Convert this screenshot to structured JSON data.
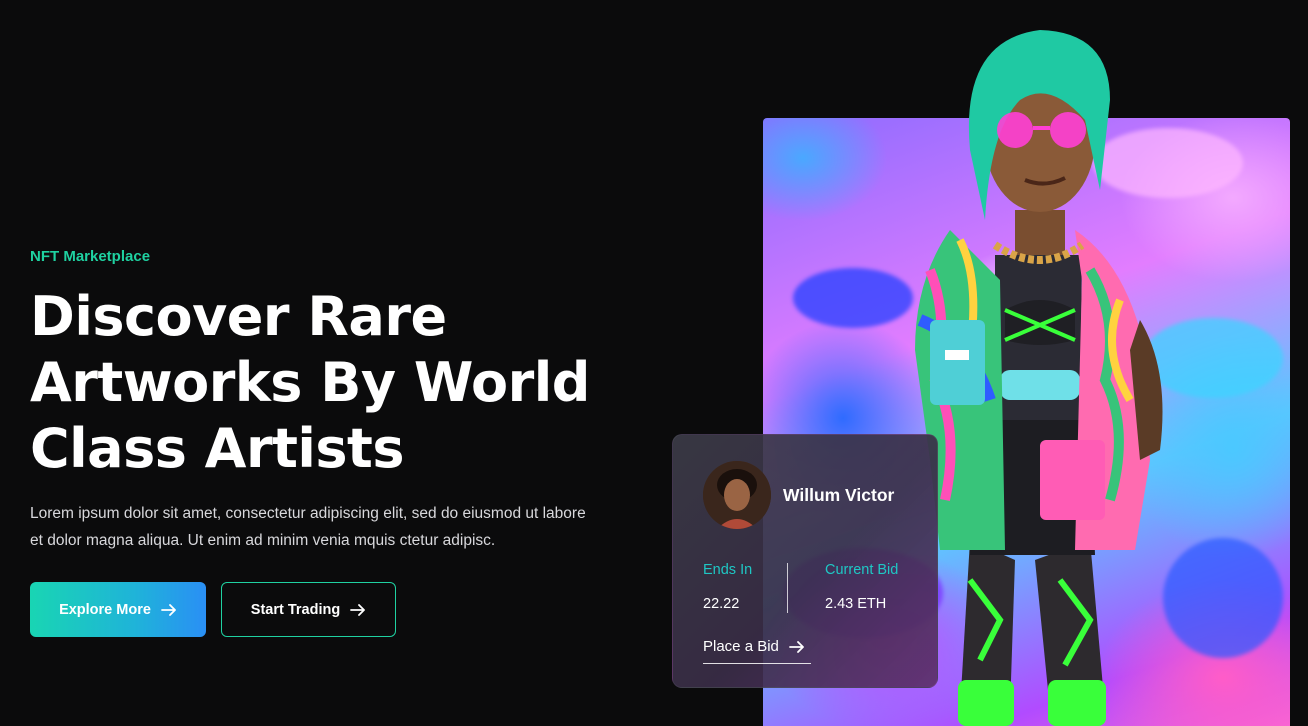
{
  "hero": {
    "eyebrow": "NFT Marketplace",
    "headline_lines": [
      "Discover Rare",
      "Artworks By World",
      "Class Artists"
    ],
    "description_lines": [
      "Lorem ipsum dolor sit amet, consectetur adipiscing elit, sed do eiusmod ut labore",
      "et dolor magna aliqua. Ut enim ad minim venia mquis ctetur adipisc."
    ],
    "primary_button": {
      "label": "Explore More",
      "icon": "arrow-right-icon"
    },
    "secondary_button": {
      "label": "Start Trading",
      "icon": "arrow-right-icon"
    }
  },
  "bid_card": {
    "creator_name": "Willum Victor",
    "ends_in_label": "Ends In",
    "ends_in_value": "22.22",
    "current_bid_label": "Current Bid",
    "current_bid_value": "2.43 ETH",
    "place_bid_label": "Place a Bid"
  },
  "colors": {
    "background": "#0b0b0c",
    "accent": "#1fd1a1",
    "gradient_start": "#19d5b3",
    "gradient_end": "#2a8ff5"
  }
}
